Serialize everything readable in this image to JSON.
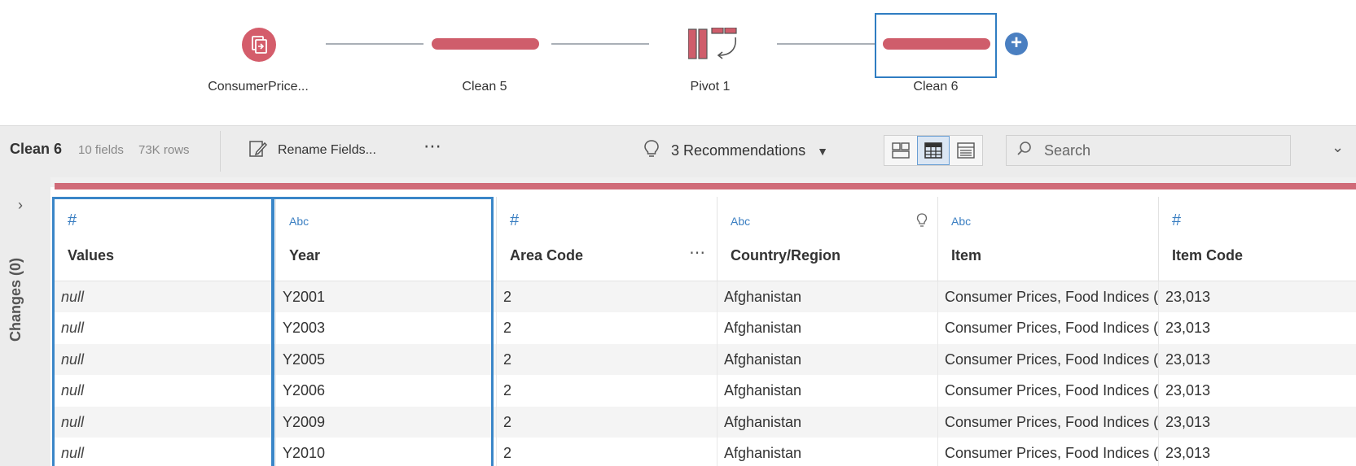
{
  "flow": {
    "steps": [
      {
        "label": "ConsumerPrice...",
        "kind": "input"
      },
      {
        "label": "Clean 5",
        "kind": "clean"
      },
      {
        "label": "Pivot 1",
        "kind": "pivot"
      },
      {
        "label": "Clean 6",
        "kind": "clean",
        "selected": true
      }
    ],
    "add_icon": "+"
  },
  "toolbar": {
    "title": "Clean 6",
    "fields": "10 fields",
    "rows": "73K rows",
    "rename_label": "Rename Fields...",
    "more_label": "⋯",
    "recommendations_label": "3 Recommendations",
    "search_placeholder": "Search"
  },
  "sidebar": {
    "changes_label": "Changes (0)"
  },
  "grid": {
    "columns": [
      {
        "type": "#",
        "name": "Values"
      },
      {
        "type": "Abc",
        "name": "Year"
      },
      {
        "type": "#",
        "name": "Area Code"
      },
      {
        "type": "Abc",
        "name": "Country/Region"
      },
      {
        "type": "Abc",
        "name": "Item"
      },
      {
        "type": "#",
        "name": "Item Code"
      }
    ],
    "rows": [
      [
        "null",
        "Y2001",
        "2",
        "Afghanistan",
        "Consumer Prices, Food Indices (",
        "23,013"
      ],
      [
        "null",
        "Y2003",
        "2",
        "Afghanistan",
        "Consumer Prices, Food Indices (",
        "23,013"
      ],
      [
        "null",
        "Y2005",
        "2",
        "Afghanistan",
        "Consumer Prices, Food Indices (",
        "23,013"
      ],
      [
        "null",
        "Y2006",
        "2",
        "Afghanistan",
        "Consumer Prices, Food Indices (",
        "23,013"
      ],
      [
        "null",
        "Y2009",
        "2",
        "Afghanistan",
        "Consumer Prices, Food Indices (",
        "23,013"
      ],
      [
        "null",
        "Y2010",
        "2",
        "Afghanistan",
        "Consumer Prices, Food Indices (",
        "23,013"
      ]
    ]
  },
  "colors": {
    "accent": "#cf5d6b",
    "selection": "#3a86c8",
    "type_blue": "#3b7fc2",
    "toolbar_bg": "#ececec"
  }
}
